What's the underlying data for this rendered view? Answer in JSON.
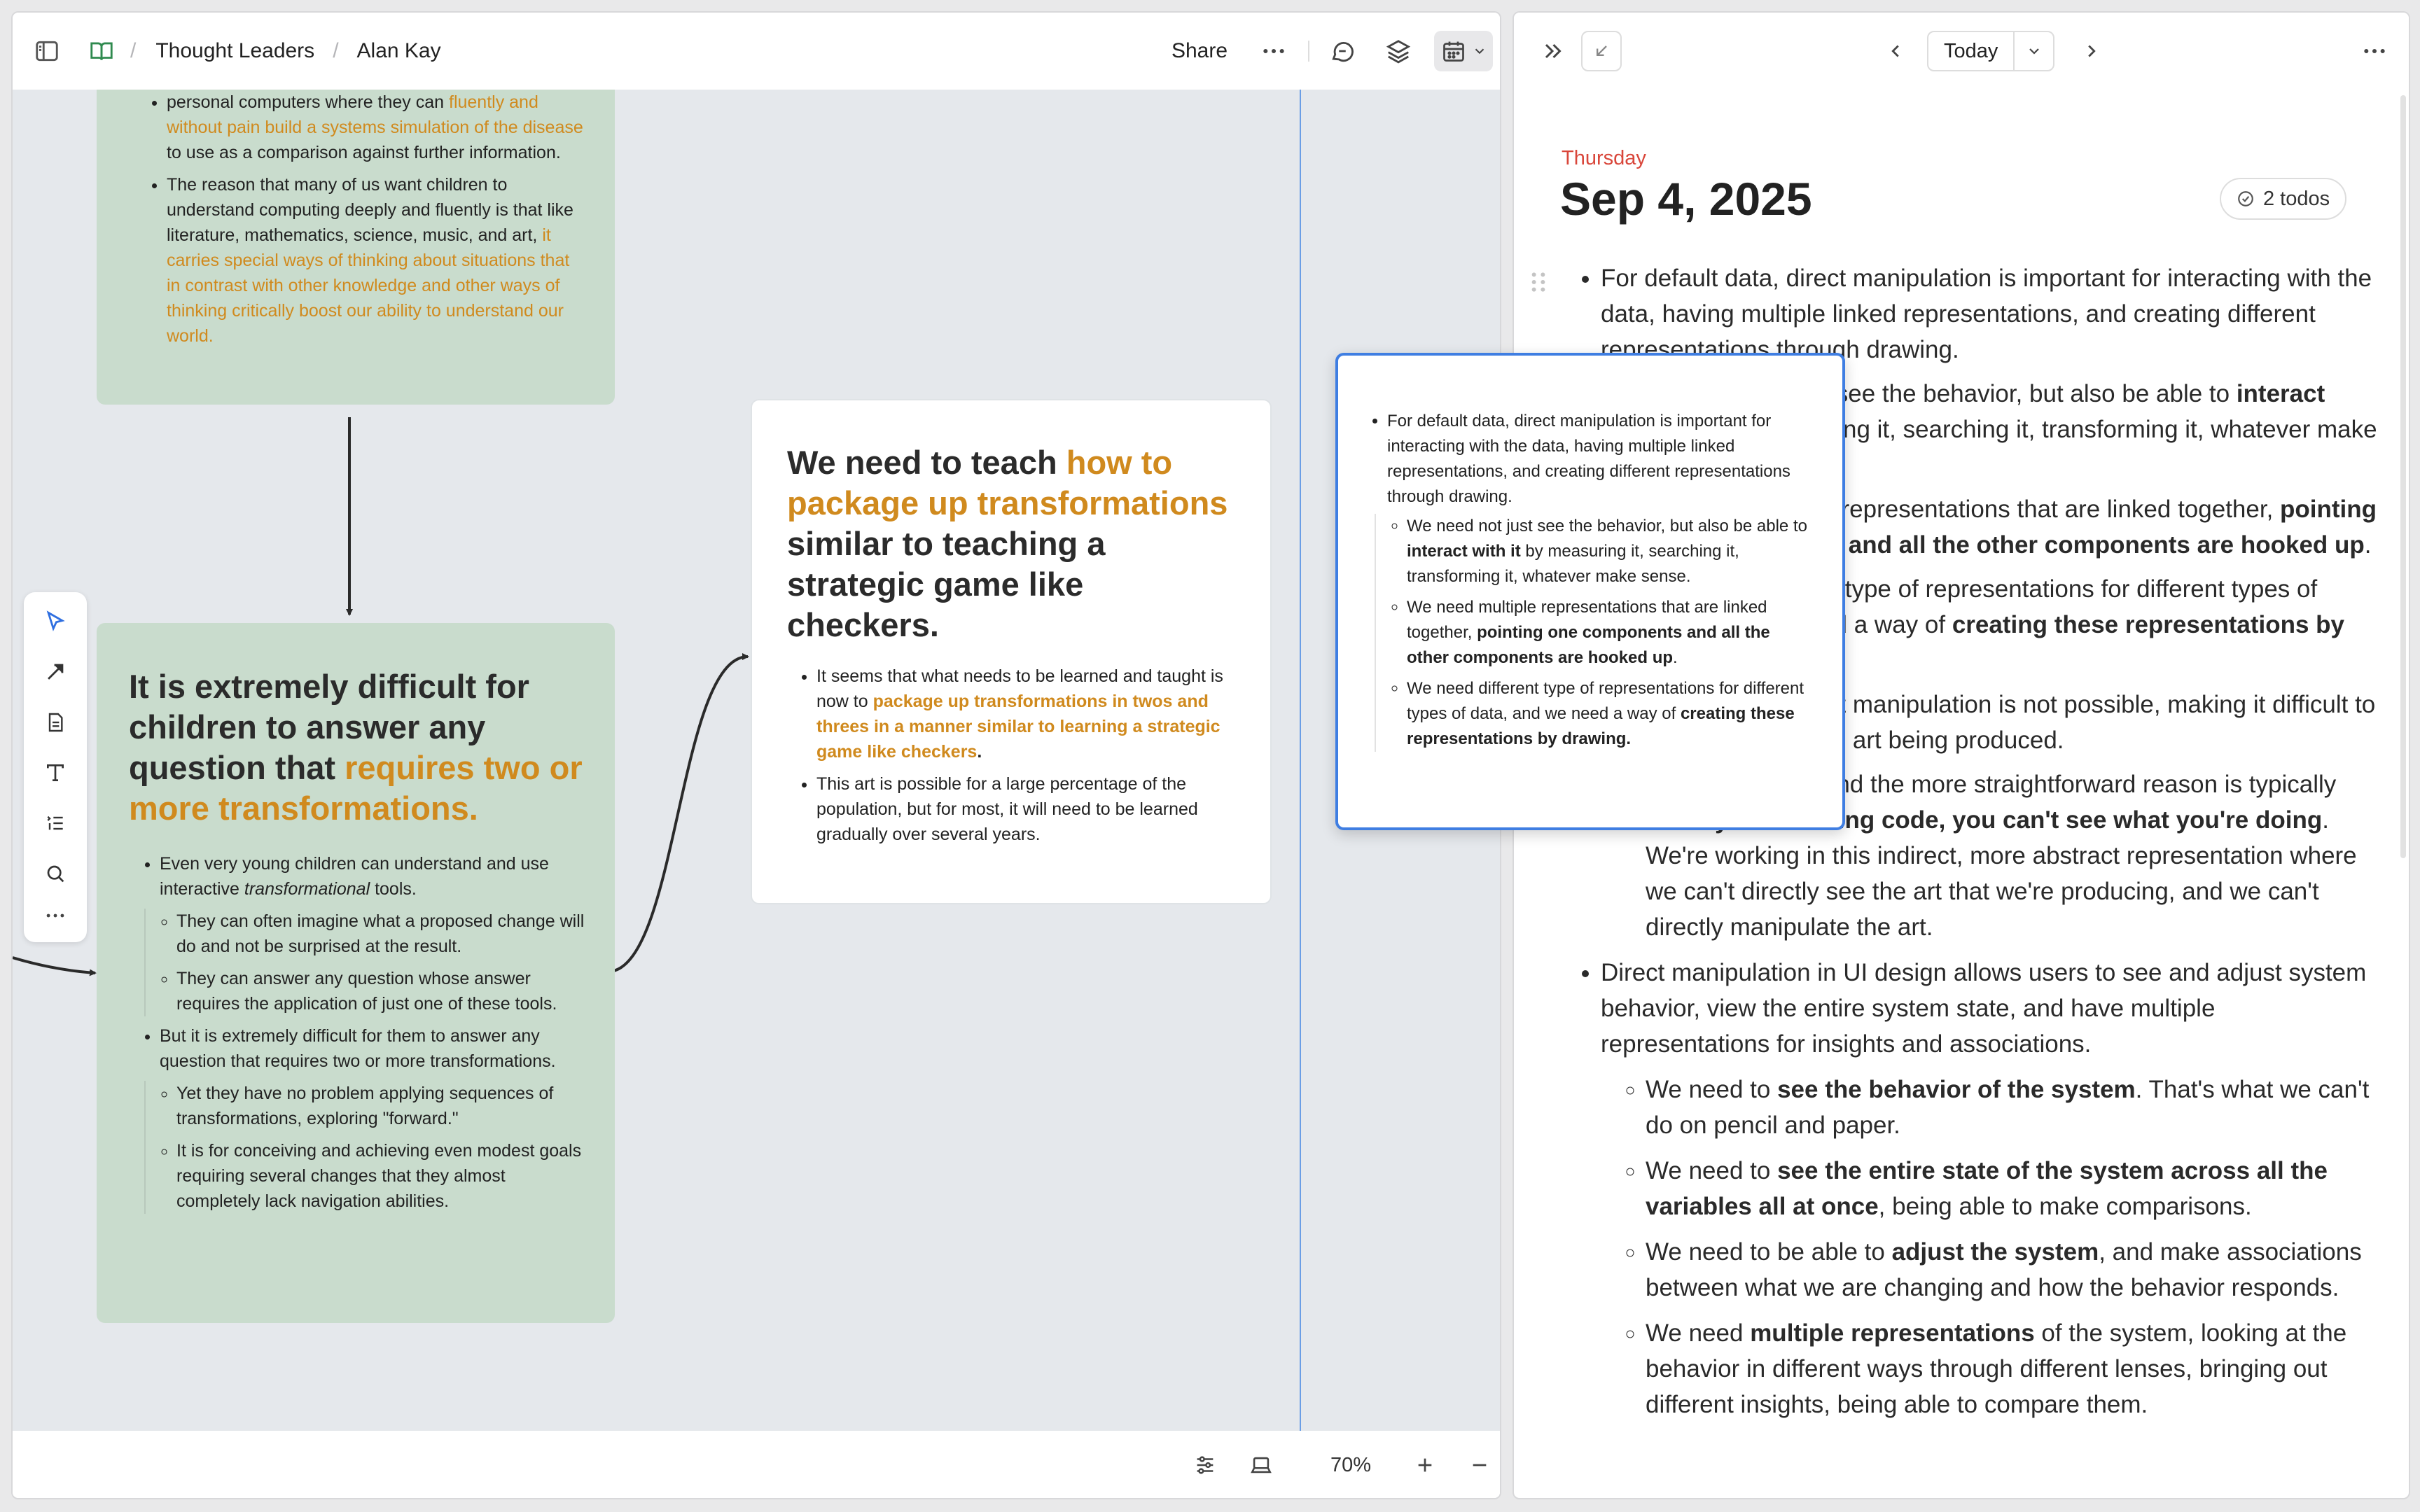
{
  "breadcrumb": {
    "parent": "Thought Leaders",
    "separator": "/",
    "current": "Alan Kay"
  },
  "left_header": {
    "share_label": "Share"
  },
  "cards": {
    "top_green": {
      "i1_a": "personal computers where they can ",
      "i1_b": "fluently and without pain build a systems simulation of the disease",
      "i1_c": " to use as a comparison against further information.",
      "i2_a": "The reason that many of us want children to understand computing deeply and fluently is that like literature, mathematics, science, music, and art, ",
      "i2_b": "it carries special ways of thinking about situations that in contrast with other knowledge and other ways of thinking critically boost our ability to understand our world."
    },
    "left_green": {
      "title_a": "It is extremely difficult for children to answer any question that ",
      "title_b": "requires two or more transformations.",
      "i1_a": "Even very young children can understand and use interactive ",
      "i1_em": "transformational",
      "i1_c": " tools.",
      "i1_s1": "They can often imagine what a proposed change will do and not be surprised at the result.",
      "i1_s2": "They can answer any question whose answer requires the application of just one of these tools.",
      "i2": "But it is extremely difficult for them to answer any question that requires two or more transformations.",
      "i2_s1": "Yet they have no problem applying sequences of transformations, exploring \"forward.\"",
      "i2_s2": "It is for conceiving and achieving even modest goals requiring several changes that they almost completely lack navigation abilities."
    },
    "white": {
      "title_a": "We need to teach ",
      "title_b": "how to package up transformations",
      "title_c": " similar to teaching a strategic game like checkers.",
      "i1_a": "It seems that what needs to be learned and taught is now to ",
      "i1_b": "package up transformations in twos and threes in a manner similar to learning a strategic game like checkers",
      "i1_c": ".",
      "i2": "This art is possible for a large percentage of the population, but for most, it will need to be learned gradually over several years."
    }
  },
  "bottom_bar": {
    "zoom": "70%"
  },
  "journal": {
    "today_label": "Today",
    "weekday": "Thursday",
    "date": "Sep 4, 2025",
    "todos": "2 todos",
    "b1": "For default data, direct manipulation is important for interacting with the data, having multiple linked representations, and creating different representations through drawing.",
    "b1_s1_a": "We need not just see the behavior, but also be able to ",
    "b1_s1_b": "interact with it",
    "b1_s1_c": " by measuring it, searching it, transforming it, whatever make sense.",
    "b1_s2_a": "We need multiple representations that are linked together, ",
    "b1_s2_b": "pointing one components and all the other components are hooked up",
    "b1_s2_c": ".",
    "b1_s3_a": "We need different type of representations for different types of data, and we need a way of ",
    "b1_s3_b": "creating these representations by drawing.",
    "b2": "In programming, direct manipulation is not possible, making it difficult to directly manipulate the art being produced.",
    "b2_s1_a": "The first reason and the more straightforward reason is typically ",
    "b2_s1_b": "when you're writing code, you can't see what you're doing",
    "b2_s1_c": ". We're working in this indirect, more abstract representation where we can't directly see the art that we're producing, and we can't directly manipulate the art.",
    "b3": "Direct manipulation in UI design allows users to see and adjust system behavior, view the entire system state, and have multiple representations for insights and associations.",
    "b3_s1_a": "We need to ",
    "b3_s1_b": "see the behavior of the system",
    "b3_s1_c": ". That's what we can't do on pencil and paper.",
    "b3_s2_a": "We need to ",
    "b3_s2_b": "see the entire state of the system across all the variables all at once",
    "b3_s2_c": ", being able to make comparisons.",
    "b3_s3_a": "We need to be able to ",
    "b3_s3_b": "adjust the system",
    "b3_s3_c": ", and make associations between what we are changing and how the behavior responds.",
    "b3_s4_a": "We need ",
    "b3_s4_b": "multiple representations",
    "b3_s4_c": " of the system, looking at the behavior in different ways through different lenses, bringing out different insights, being able to compare them."
  },
  "colors": {
    "accent_orange": "#d08a1e",
    "card_green": "#c9dccd",
    "selection_blue": "#3f7ee2",
    "weekday_red": "#d9463a"
  },
  "icons": [
    "sidebar-toggle-icon",
    "book-icon",
    "more-icon",
    "chat-icon",
    "layers-icon",
    "calendar-icon",
    "chevron-down-icon",
    "double-chevron-right-icon",
    "collapse-corner-icon",
    "chevron-left-icon",
    "chevron-right-icon",
    "pointer-icon",
    "arrow-tool-icon",
    "page-icon",
    "text-icon",
    "list-icon",
    "search-icon",
    "sliders-icon",
    "laptop-icon",
    "plus-icon",
    "minus-icon",
    "todo-check-icon",
    "drag-handle-icon"
  ]
}
